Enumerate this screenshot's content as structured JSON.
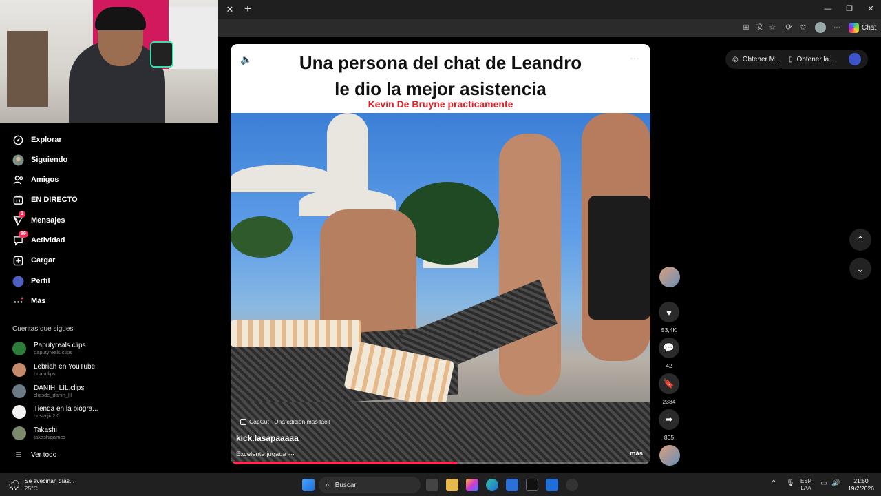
{
  "browser": {
    "chat_label": "Chat",
    "icons": [
      "close-icon",
      "plus-icon",
      "minimize-icon",
      "restore-icon",
      "close-window-icon"
    ]
  },
  "sidebar": {
    "items": [
      {
        "label": "Explorar",
        "icon": "compass-icon"
      },
      {
        "label": "Siguiendo",
        "icon": "avatar-icon"
      },
      {
        "label": "Amigos",
        "icon": "people-icon"
      },
      {
        "label": "EN DIRECTO",
        "icon": "live-icon"
      },
      {
        "label": "Mensajes",
        "icon": "send-icon",
        "badge": "2"
      },
      {
        "label": "Actividad",
        "icon": "chat-icon",
        "badge": "99"
      },
      {
        "label": "Cargar",
        "icon": "plus-square-icon"
      },
      {
        "label": "Perfil",
        "icon": "profile-icon"
      },
      {
        "label": "Más",
        "icon": "dots-icon"
      }
    ],
    "following_title": "Cuentas que sigues",
    "following": [
      {
        "name": "Paputyreals.clips",
        "handle": "paputyreals.clips",
        "color": "#2d7d3a"
      },
      {
        "name": "Lebriah en YouTube",
        "handle": "briahclips",
        "color": "#c48a6a"
      },
      {
        "name": "DANIH_LIL.clips",
        "handle": "clipsde_danih_lil",
        "color": "#6b7a86"
      },
      {
        "name": "Tienda en la biogra...",
        "handle": "nostaljic2.0",
        "color": "#f2f2f2"
      },
      {
        "name": "Takashi",
        "handle": "takashigames",
        "color": "#7a8a6a"
      }
    ],
    "see_all": "Ver todo"
  },
  "video": {
    "title_line1": "Una persona del chat de Leandro",
    "title_line2": "le dio la mejor asistencia",
    "subtitle": "Kevin De Bruyne practicamente",
    "capcut": "CapCut · Una edición más fácil",
    "author": "kick.lasapaaaaa",
    "description": "Excelente jugada ···",
    "more": "más",
    "progress": 0.54
  },
  "actions": {
    "likes": "53,4K",
    "comments": "42",
    "saves": "2384",
    "shares": "865"
  },
  "top_right": {
    "pill1": "Obtener M...",
    "pill2": "Obtener la..."
  },
  "taskbar": {
    "weather_text": "Se avecinan días...",
    "temp": "25°C",
    "search": "Buscar",
    "lang1": "ESP",
    "lang2": "LAA",
    "time": "21:50",
    "date": "19/2/2026"
  }
}
